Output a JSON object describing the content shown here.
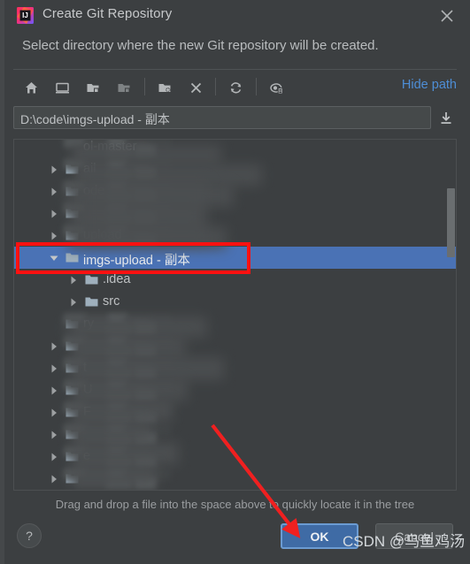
{
  "window": {
    "title": "Create Git Repository",
    "app_icon": "intellij-idea-icon",
    "close_label": "×",
    "subtitle": "Select directory where the new Git repository will be created."
  },
  "toolbar": {
    "buttons": [
      {
        "name": "home-icon",
        "tooltip": "Home"
      },
      {
        "name": "desktop-icon",
        "tooltip": "Desktop"
      },
      {
        "name": "project-folder-icon",
        "tooltip": "Project Directory"
      },
      {
        "name": "module-folder-icon",
        "tooltip": "Module Directory"
      },
      {
        "name": "new-folder-icon",
        "tooltip": "New Folder"
      },
      {
        "name": "delete-icon",
        "tooltip": "Delete"
      },
      {
        "name": "refresh-icon",
        "tooltip": "Refresh"
      },
      {
        "name": "show-hidden-files-icon",
        "tooltip": "Show Hidden Files"
      }
    ],
    "hide_path_label": "Hide path"
  },
  "path_field": {
    "value": "D:\\code\\imgs-upload - 副本",
    "placeholder": "",
    "download_icon": "download-icon"
  },
  "tree": {
    "rows": [
      {
        "label": "ol-master",
        "indent": 0,
        "twisty": "none",
        "censored": true,
        "folder": false
      },
      {
        "label": "ail",
        "indent": 0,
        "twisty": "collapsed",
        "censored": true,
        "folder": true
      },
      {
        "label": "ode",
        "indent": 0,
        "twisty": "collapsed",
        "censored": true,
        "folder": true
      },
      {
        "label": "",
        "indent": 0,
        "twisty": "collapsed",
        "censored": true,
        "folder": true
      },
      {
        "label": "upload",
        "indent": 0,
        "twisty": "collapsed",
        "censored": true,
        "folder": true
      },
      {
        "label": "imgs-upload - 副本",
        "indent": 0,
        "twisty": "expanded",
        "censored": false,
        "folder": true,
        "selected": true
      },
      {
        "label": ".idea",
        "indent": 1,
        "twisty": "collapsed",
        "censored": false,
        "folder": true
      },
      {
        "label": "src",
        "indent": 1,
        "twisty": "collapsed",
        "censored": false,
        "folder": true
      },
      {
        "label": "ry",
        "indent": 0,
        "twisty": "none",
        "censored": true,
        "folder": true
      },
      {
        "label": "",
        "indent": 0,
        "twisty": "collapsed",
        "censored": true,
        "folder": true
      },
      {
        "label": "t",
        "indent": 0,
        "twisty": "collapsed",
        "censored": true,
        "folder": true
      },
      {
        "label": "U",
        "indent": 0,
        "twisty": "collapsed",
        "censored": true,
        "folder": true
      },
      {
        "label": "F",
        "indent": 0,
        "twisty": "collapsed",
        "censored": true,
        "folder": true
      },
      {
        "label": "",
        "indent": 0,
        "twisty": "collapsed",
        "censored": true,
        "folder": true
      },
      {
        "label": "e",
        "indent": 0,
        "twisty": "collapsed",
        "censored": true,
        "folder": true
      },
      {
        "label": "",
        "indent": 0,
        "twisty": "collapsed",
        "censored": true,
        "folder": true
      }
    ],
    "scrollbar": {
      "name": "vertical-scrollbar"
    }
  },
  "hint": "Drag and drop a file into the space above to quickly locate it in the tree",
  "footer": {
    "help_label": "?",
    "ok_label": "OK",
    "cancel_label": "Cancel"
  },
  "annotations": {
    "highlight_color": "#fe1111",
    "arrow_color": "#f02020",
    "watermark": "CSDN @乌鱼鸡汤"
  },
  "colors": {
    "dialog_bg": "#3c3f41",
    "selection_blue": "#4a72b5",
    "link_blue": "#4e8ed6",
    "ok_button": "#3f6ba5",
    "text": "#bec1c3"
  }
}
